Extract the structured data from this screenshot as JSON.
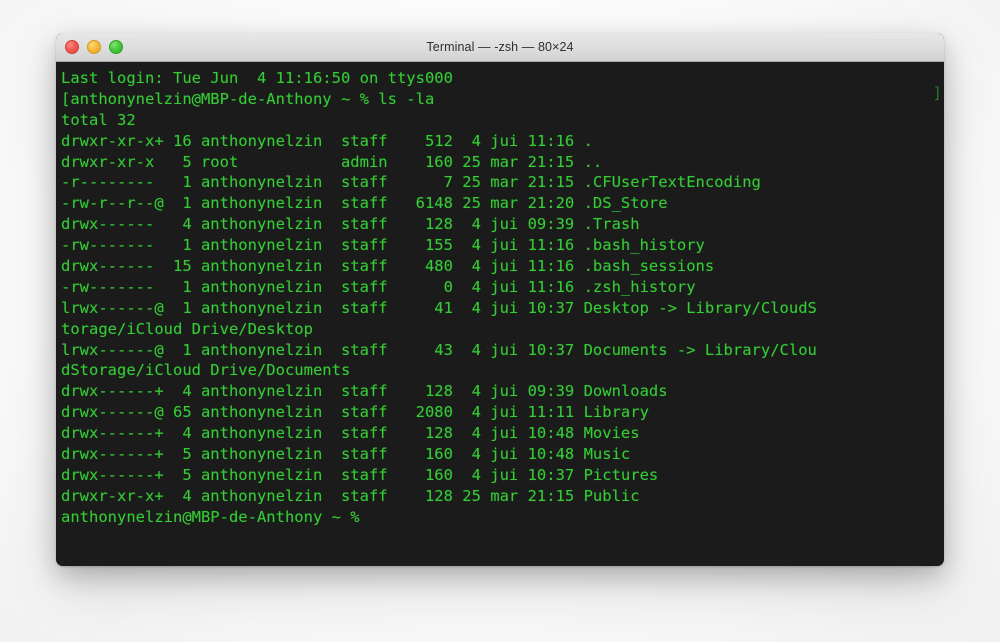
{
  "window": {
    "title": "Terminal — -zsh — 80×24",
    "traffic_lights": [
      {
        "name": "close",
        "color": "#f25b52"
      },
      {
        "name": "minimize",
        "color": "#f5bb3d"
      },
      {
        "name": "zoom",
        "color": "#49c73e"
      }
    ]
  },
  "theme": {
    "background": "#1b1b1b",
    "foreground": "#35cc35",
    "titlebar_background": "#dedede",
    "titlebar_text": "#2f2f2f",
    "desktop_background": "#f2f2f2"
  },
  "terminal": {
    "columns": 80,
    "rows": 24,
    "shell": "-zsh",
    "wrap_marker": "]",
    "lines": [
      "Last login: Tue Jun  4 11:16:50 on ttys000",
      "[anthonynelzin@MBP-de-Anthony ~ % ls -la",
      "total 32",
      "drwxr-xr-x+ 16 anthonynelzin  staff    512  4 jui 11:16 .",
      "drwxr-xr-x   5 root           admin    160 25 mar 21:15 ..",
      "-r--------   1 anthonynelzin  staff      7 25 mar 21:15 .CFUserTextEncoding",
      "-rw-r--r--@  1 anthonynelzin  staff   6148 25 mar 21:20 .DS_Store",
      "drwx------   4 anthonynelzin  staff    128  4 jui 09:39 .Trash",
      "-rw-------   1 anthonynelzin  staff    155  4 jui 11:16 .bash_history",
      "drwx------  15 anthonynelzin  staff    480  4 jui 11:16 .bash_sessions",
      "-rw-------   1 anthonynelzin  staff      0  4 jui 11:16 .zsh_history",
      "lrwx------@  1 anthonynelzin  staff     41  4 jui 10:37 Desktop -> Library/CloudS",
      "torage/iCloud Drive/Desktop",
      "lrwx------@  1 anthonynelzin  staff     43  4 jui 10:37 Documents -> Library/Clou",
      "dStorage/iCloud Drive/Documents",
      "drwx------+  4 anthonynelzin  staff    128  4 jui 09:39 Downloads",
      "drwx------@ 65 anthonynelzin  staff   2080  4 jui 11:11 Library",
      "drwx------+  4 anthonynelzin  staff    128  4 jui 10:48 Movies",
      "drwx------+  5 anthonynelzin  staff    160  4 jui 10:48 Music",
      "drwx------+  5 anthonynelzin  staff    160  4 jui 10:37 Pictures",
      "drwxr-xr-x+  4 anthonynelzin  staff    128 25 mar 21:15 Public",
      "anthonynelzin@MBP-de-Anthony ~ %"
    ],
    "session": {
      "last_login_day": "Tue Jun  4",
      "last_login_time": "11:16:50",
      "tty": "ttys000",
      "user": "anthonynelzin",
      "host": "MBP-de-Anthony",
      "cwd": "~",
      "prompt_symbol": "%",
      "command": "ls -la",
      "total_blocks": "total 32"
    },
    "listing": [
      {
        "perms": "drwxr-xr-x+",
        "links": "16",
        "owner": "anthonynelzin",
        "group": "staff",
        "size": "512",
        "month_day": " 4 jui",
        "time": "11:16",
        "name": "."
      },
      {
        "perms": "drwxr-xr-x",
        "links": "5",
        "owner": "root",
        "group": "admin",
        "size": "160",
        "month_day": "25 mar",
        "time": "21:15",
        "name": ".."
      },
      {
        "perms": "-r--------",
        "links": "1",
        "owner": "anthonynelzin",
        "group": "staff",
        "size": "7",
        "month_day": "25 mar",
        "time": "21:15",
        "name": ".CFUserTextEncoding"
      },
      {
        "perms": "-rw-r--r--@",
        "links": "1",
        "owner": "anthonynelzin",
        "group": "staff",
        "size": "6148",
        "month_day": "25 mar",
        "time": "21:20",
        "name": ".DS_Store"
      },
      {
        "perms": "drwx------",
        "links": "4",
        "owner": "anthonynelzin",
        "group": "staff",
        "size": "128",
        "month_day": " 4 jui",
        "time": "09:39",
        "name": ".Trash"
      },
      {
        "perms": "-rw-------",
        "links": "1",
        "owner": "anthonynelzin",
        "group": "staff",
        "size": "155",
        "month_day": " 4 jui",
        "time": "11:16",
        "name": ".bash_history"
      },
      {
        "perms": "drwx------",
        "links": "15",
        "owner": "anthonynelzin",
        "group": "staff",
        "size": "480",
        "month_day": " 4 jui",
        "time": "11:16",
        "name": ".bash_sessions"
      },
      {
        "perms": "-rw-------",
        "links": "1",
        "owner": "anthonynelzin",
        "group": "staff",
        "size": "0",
        "month_day": " 4 jui",
        "time": "11:16",
        "name": ".zsh_history"
      },
      {
        "perms": "lrwx------@",
        "links": "1",
        "owner": "anthonynelzin",
        "group": "staff",
        "size": "41",
        "month_day": " 4 jui",
        "time": "10:37",
        "name": "Desktop -> Library/CloudStorage/iCloud Drive/Desktop"
      },
      {
        "perms": "lrwx------@",
        "links": "1",
        "owner": "anthonynelzin",
        "group": "staff",
        "size": "43",
        "month_day": " 4 jui",
        "time": "10:37",
        "name": "Documents -> Library/CloudStorage/iCloud Drive/Documents"
      },
      {
        "perms": "drwx------+",
        "links": "4",
        "owner": "anthonynelzin",
        "group": "staff",
        "size": "128",
        "month_day": " 4 jui",
        "time": "09:39",
        "name": "Downloads"
      },
      {
        "perms": "drwx------@",
        "links": "65",
        "owner": "anthonynelzin",
        "group": "staff",
        "size": "2080",
        "month_day": " 4 jui",
        "time": "11:11",
        "name": "Library"
      },
      {
        "perms": "drwx------+",
        "links": "4",
        "owner": "anthonynelzin",
        "group": "staff",
        "size": "128",
        "month_day": " 4 jui",
        "time": "10:48",
        "name": "Movies"
      },
      {
        "perms": "drwx------+",
        "links": "5",
        "owner": "anthonynelzin",
        "group": "staff",
        "size": "160",
        "month_day": " 4 jui",
        "time": "10:48",
        "name": "Music"
      },
      {
        "perms": "drwx------+",
        "links": "5",
        "owner": "anthonynelzin",
        "group": "staff",
        "size": "160",
        "month_day": " 4 jui",
        "time": "10:37",
        "name": "Pictures"
      },
      {
        "perms": "drwxr-xr-x+",
        "links": "4",
        "owner": "anthonynelzin",
        "group": "staff",
        "size": "128",
        "month_day": "25 mar",
        "time": "21:15",
        "name": "Public"
      }
    ]
  }
}
